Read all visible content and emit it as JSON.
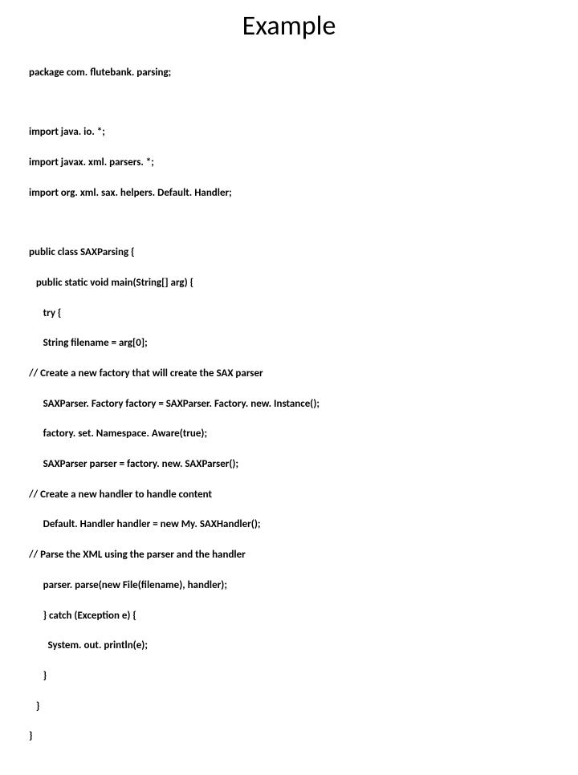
{
  "title": "Example",
  "code": {
    "l1": "package com. flutebank. parsing;",
    "l2": "import java. io. *;",
    "l3": "import javax. xml. parsers. *;",
    "l4": "import org. xml. sax. helpers. Default. Handler;",
    "l5": "public class SAXParsing {",
    "l6": "   public static void main(String[] arg) {",
    "l7": "      try {",
    "l8": "      String filename = arg[0];",
    "l9": "// Create a new factory that will create the SAX parser",
    "l10": "      SAXParser. Factory factory = SAXParser. Factory. new. Instance();",
    "l11": "      factory. set. Namespace. Aware(true);",
    "l12": "      SAXParser parser = factory. new. SAXParser();",
    "l13": "// Create a new handler to handle content",
    "l14": "      Default. Handler handler = new My. SAXHandler();",
    "l15": "// Parse the XML using the parser and the handler",
    "l16": "      parser. parse(new File(filename), handler);",
    "l17": "      } catch (Exception e) {",
    "l18": "        System. out. println(e);",
    "l19": "      }",
    "l20": "   }",
    "l21": "}"
  }
}
